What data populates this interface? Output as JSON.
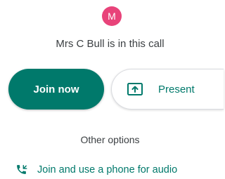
{
  "participant": {
    "avatar_initial": "M",
    "in_call_text": "Mrs C Bull is in this call"
  },
  "actions": {
    "join_label": "Join now",
    "present_label": "Present"
  },
  "other_options": {
    "heading": "Other options",
    "phone_label": "Join and use a phone for audio"
  },
  "colors": {
    "accent": "#00796b",
    "avatar_bg": "#e8437a"
  },
  "icons": {
    "present": "present-screen-icon",
    "phone": "phone-call-icon"
  }
}
